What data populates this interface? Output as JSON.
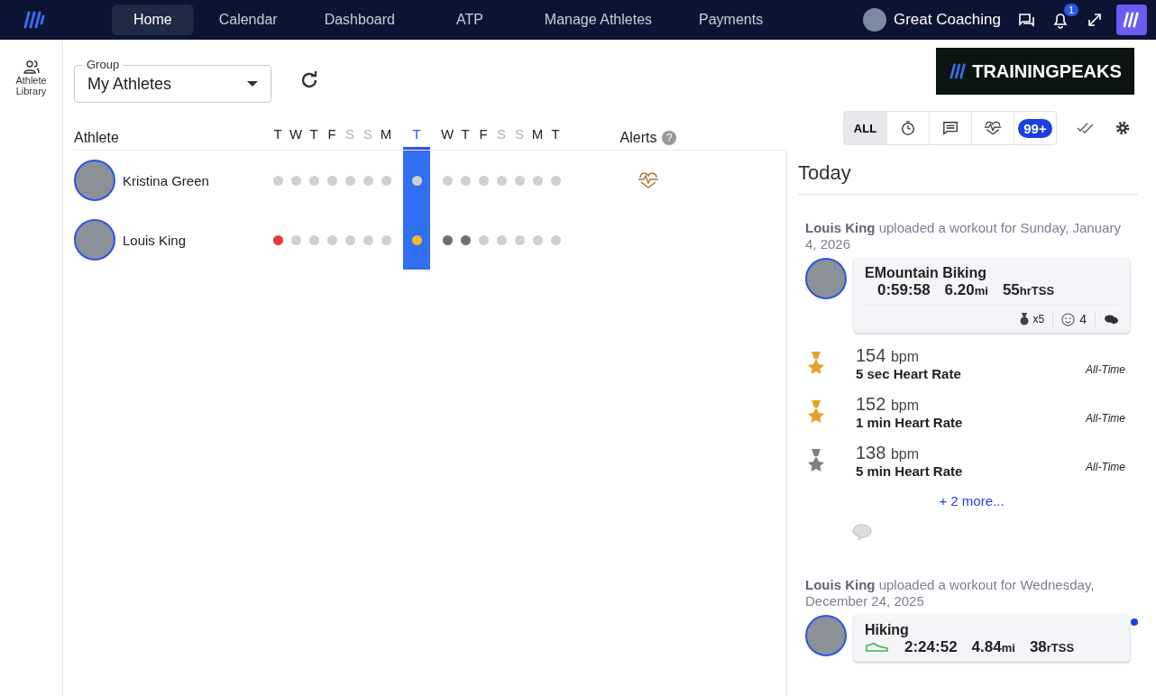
{
  "nav": {
    "items": [
      {
        "label": "Home",
        "selected": true
      },
      {
        "label": "Calendar",
        "selected": false
      },
      {
        "label": "Dashboard",
        "selected": false
      },
      {
        "label": "ATP",
        "selected": false
      },
      {
        "label": "Manage Athletes",
        "selected": false
      },
      {
        "label": "Payments",
        "selected": false
      }
    ],
    "user": "Great Coaching",
    "notifications": "1"
  },
  "sidebar": {
    "label": "Athlete Library"
  },
  "group": {
    "label": "Group",
    "value": "My Athletes"
  },
  "brand": "TRAININGPEAKS",
  "table": {
    "athlete_heading": "Athlete",
    "alerts_heading": "Alerts",
    "alerts_help": "?",
    "days": [
      {
        "label": "T",
        "weekend": false,
        "selected": false
      },
      {
        "label": "W",
        "weekend": false,
        "selected": false
      },
      {
        "label": "T",
        "weekend": false,
        "selected": false
      },
      {
        "label": "F",
        "weekend": false,
        "selected": false
      },
      {
        "label": "S",
        "weekend": true,
        "selected": false
      },
      {
        "label": "S",
        "weekend": true,
        "selected": false
      },
      {
        "label": "M",
        "weekend": false,
        "selected": false
      },
      {
        "label": "T",
        "weekend": false,
        "selected": true
      },
      {
        "label": "W",
        "weekend": false,
        "selected": false
      },
      {
        "label": "T",
        "weekend": false,
        "selected": false
      },
      {
        "label": "F",
        "weekend": false,
        "selected": false
      },
      {
        "label": "S",
        "weekend": true,
        "selected": false
      },
      {
        "label": "S",
        "weekend": true,
        "selected": false
      },
      {
        "label": "M",
        "weekend": false,
        "selected": false
      },
      {
        "label": "T",
        "weekend": false,
        "selected": false
      }
    ],
    "rows": [
      {
        "name": "Kristina Green",
        "alert": true,
        "days": [
          {
            "color": "#d0d0d4"
          },
          {
            "color": "#d0d0d4"
          },
          {
            "color": "#d0d0d4"
          },
          {
            "color": "#d0d0d4"
          },
          {
            "color": "#d0d0d4"
          },
          {
            "color": "#d0d0d4"
          },
          {
            "color": "#d0d0d4"
          },
          {
            "color": "#d0d0d4"
          },
          {
            "color": "#d0d0d4"
          },
          {
            "color": "#d0d0d4"
          },
          {
            "color": "#d0d0d4"
          },
          {
            "color": "#d0d0d4"
          },
          {
            "color": "#d0d0d4"
          },
          {
            "color": "#d0d0d4"
          },
          {
            "color": "#d0d0d4"
          }
        ]
      },
      {
        "name": "Louis King",
        "alert": false,
        "days": [
          {
            "color": "#e53935"
          },
          {
            "color": "#d0d0d4"
          },
          {
            "color": "#d0d0d4"
          },
          {
            "color": "#d0d0d4"
          },
          {
            "color": "#d0d0d4"
          },
          {
            "color": "#d0d0d4"
          },
          {
            "color": "#d0d0d4"
          },
          {
            "color": "#f5b82e"
          },
          {
            "color": "#6b6f78"
          },
          {
            "color": "#6b6f78"
          },
          {
            "color": "#d0d0d4"
          },
          {
            "color": "#d0d0d4"
          },
          {
            "color": "#d0d0d4"
          },
          {
            "color": "#d0d0d4"
          },
          {
            "color": "#d0d0d4"
          }
        ]
      }
    ]
  },
  "filters": [
    {
      "kind": "label",
      "label": "ALL",
      "selected": true
    },
    {
      "kind": "timer",
      "selected": false
    },
    {
      "kind": "comment",
      "selected": false
    },
    {
      "kind": "heart",
      "selected": false
    },
    {
      "kind": "count",
      "label": "99+",
      "selected": false
    }
  ],
  "feed": {
    "title": "Today",
    "items": [
      {
        "unread": false,
        "text": "**Louis King** uploaded a workout for Sunday, January 4, 2026",
        "workout": {
          "kind": "bike",
          "title": "EMountain Biking",
          "duration": "0:59:58",
          "distance": "6.20",
          "distance_unit": "mi",
          "tss": "55",
          "tss_unit": "hrTSS",
          "medals": "x5",
          "likes": "4"
        },
        "records": [
          {
            "kind": "gold",
            "value": "154",
            "unit": "bpm",
            "name": "5 sec Heart Rate",
            "period": "All-Time"
          },
          {
            "kind": "gold",
            "value": "152",
            "unit": "bpm",
            "name": "1 min Heart Rate",
            "period": "All-Time"
          },
          {
            "kind": "silver",
            "value": "138",
            "unit": "bpm",
            "name": "5 min Heart Rate",
            "period": "All-Time"
          }
        ],
        "more": "+ 2 more..."
      },
      {
        "unread": true,
        "text": "**Louis King** uploaded a workout for Wednesday, December 24, 2025",
        "workout": {
          "kind": "hike",
          "title": "Hiking",
          "duration": "2:24:52",
          "distance": "4.84",
          "distance_unit": "mi",
          "tss": "38",
          "tss_unit": "rTSS"
        }
      }
    ]
  }
}
